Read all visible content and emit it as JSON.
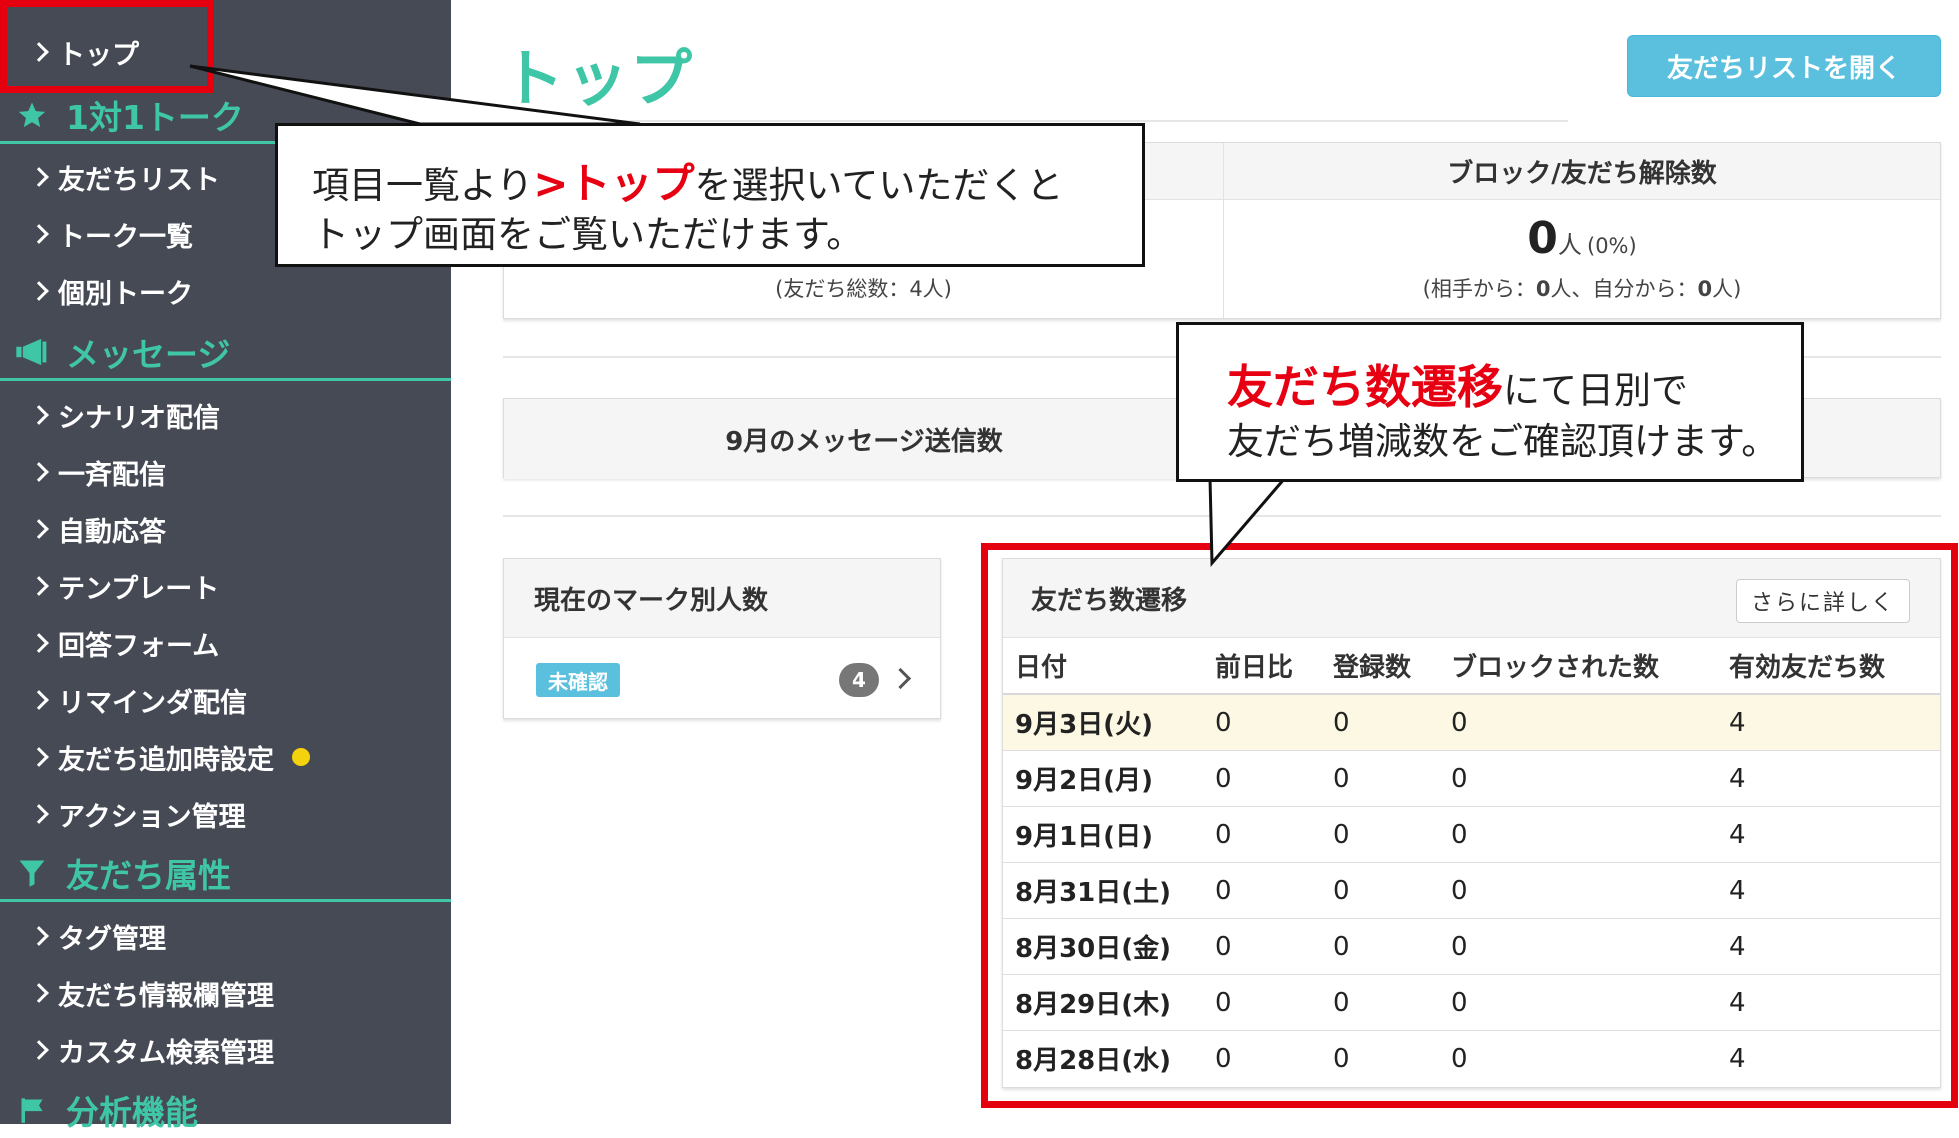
{
  "sidebar": {
    "items": [
      {
        "label": "トップ"
      },
      {
        "label": "友だちリスト"
      },
      {
        "label": "トーク一覧"
      },
      {
        "label": "個別トーク"
      },
      {
        "label": "シナリオ配信"
      },
      {
        "label": "一斉配信"
      },
      {
        "label": "自動応答"
      },
      {
        "label": "テンプレート"
      },
      {
        "label": "回答フォーム"
      },
      {
        "label": "リマインダ配信"
      },
      {
        "label": "友だち追加時設定"
      },
      {
        "label": "アクション管理"
      },
      {
        "label": "タグ管理"
      },
      {
        "label": "友だち情報欄管理"
      },
      {
        "label": "カスタム検索管理"
      }
    ],
    "sections": [
      {
        "label": "1対1トーク",
        "icon": "star-icon"
      },
      {
        "label": "メッセージ",
        "icon": "megaphone-icon"
      },
      {
        "label": "友だち属性",
        "icon": "filter-icon"
      },
      {
        "label": "分析機能",
        "icon": "flag-icon"
      }
    ]
  },
  "header": {
    "title": "トップ",
    "friends_list_button": "友だちリストを開く"
  },
  "stats": {
    "block": {
      "title": "ブロック/友だち解除数",
      "value": "0",
      "unit": "人",
      "percent": "(0%)",
      "detail_prefix": "(相手から：",
      "from_partner": "0",
      "detail_mid": "人、自分から：",
      "from_self": "0",
      "detail_suffix": "人)"
    },
    "total_friends_text": "(友だち総数：4人)"
  },
  "messages": {
    "label": "9月のメッセージ送信数"
  },
  "marks": {
    "title": "現在のマーク別人数",
    "badge": "未確認",
    "count": "4"
  },
  "transition": {
    "title": "友だち数遷移",
    "more_button": "さらに詳しく",
    "columns": [
      "日付",
      "前日比",
      "登録数",
      "ブロックされた数",
      "有効友だち数"
    ],
    "rows": [
      {
        "date": "9月3日(火)",
        "diff": "0",
        "registered": "0",
        "blocked": "0",
        "active": "4"
      },
      {
        "date": "9月2日(月)",
        "diff": "0",
        "registered": "0",
        "blocked": "0",
        "active": "4"
      },
      {
        "date": "9月1日(日)",
        "diff": "0",
        "registered": "0",
        "blocked": "0",
        "active": "4"
      },
      {
        "date": "8月31日(土)",
        "diff": "0",
        "registered": "0",
        "blocked": "0",
        "active": "4"
      },
      {
        "date": "8月30日(金)",
        "diff": "0",
        "registered": "0",
        "blocked": "0",
        "active": "4"
      },
      {
        "date": "8月29日(木)",
        "diff": "0",
        "registered": "0",
        "blocked": "0",
        "active": "4"
      },
      {
        "date": "8月28日(水)",
        "diff": "0",
        "registered": "0",
        "blocked": "0",
        "active": "4"
      }
    ]
  },
  "callouts": {
    "top": {
      "line1_pre": "項目一覧より",
      "line1_em": ">トップ",
      "line1_post": "を選択いていただくと",
      "line2": "トップ画面をご覧いただけます。"
    },
    "transition": {
      "line1_em": "友だち数遷移",
      "line1_post": "にて日別で",
      "line2": "友だち増減数をご確認頂けます。"
    }
  },
  "colors": {
    "sidebar_bg": "#464a55",
    "accent_green": "#3fc6a6",
    "button_blue": "#5bc0de",
    "annotation_red": "#e4000f",
    "highlight_row": "#fcf8e3"
  }
}
